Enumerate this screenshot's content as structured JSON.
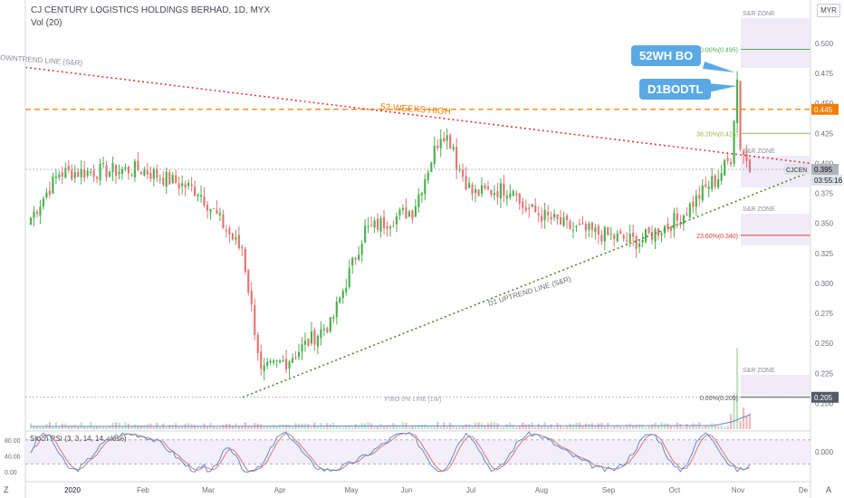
{
  "header": {
    "symbol_line": "CJ CENTURY LOGISTICS HOLDINGS BERHAD, 1D, MYX",
    "volume_label": "Vol (20)"
  },
  "currency_button": "MYR",
  "bottom_buttons": {
    "left": "Z",
    "right": "A"
  },
  "annotations": {
    "downtrend": "OWNTREND LINE (S&R)",
    "high52": "52 WEEKS HIGH",
    "uptrend": "D1 UPTREND LINE (S&R)",
    "fibo0": "FIBO 0% LINE [1W]",
    "bubble1": "52WH BO",
    "bubble2": "D1BODTL",
    "zone": "S&R ZONE",
    "fib50": "50.00%(0.495)",
    "fib38": "38.20%(0.425)",
    "fib23": "23.60%(0.340)",
    "fib0": "0.00%(0.205)"
  },
  "price_tags": {
    "orange": "0.445",
    "ticker": "CJCEN",
    "last": "0.395",
    "countdown": "03:55:16",
    "bottom": "0.205"
  },
  "colors": {
    "up": "#4caf50",
    "down": "#e57373",
    "orange": "#f57c00",
    "trend_red": "#e53935",
    "trend_green": "#4a8c2a",
    "bubble": "#5aa9e6",
    "zone": "#ece6f7",
    "stoch_k": "#5b8fd6",
    "stoch_d": "#e57373"
  },
  "chart_data": [
    {
      "type": "candlestick",
      "price_axis": {
        "ylim": [
          0.195,
          0.515
        ],
        "ticks": [
          "0.500",
          "0.475",
          "0.450",
          "0.425",
          "0.400",
          "0.375",
          "0.350",
          "0.325",
          "0.300",
          "0.275",
          "0.250",
          "0.225",
          "0.200"
        ]
      },
      "time_axis": [
        "2020",
        "Feb",
        "Mar",
        "Apr",
        "May",
        "Jun",
        "Jul",
        "Aug",
        "Sep",
        "Oct",
        "Nov",
        "De"
      ],
      "reference_levels": {
        "high_52w": 0.445,
        "last": 0.395,
        "fibo_0": 0.205
      },
      "fibonacci": [
        {
          "label": "50.00%(0.495)",
          "value": 0.495
        },
        {
          "label": "38.20%(0.425)",
          "value": 0.425
        },
        {
          "label": "23.60%(0.340)",
          "value": 0.34
        },
        {
          "label": "0.00%(0.205)",
          "value": 0.205
        }
      ],
      "phases": [
        {
          "n": 10,
          "from": 0.355,
          "to": 0.392
        },
        {
          "n": 25,
          "from": 0.392,
          "to": 0.395
        },
        {
          "n": 18,
          "from": 0.395,
          "to": 0.378
        },
        {
          "n": 14,
          "from": 0.378,
          "to": 0.33
        },
        {
          "n": 6,
          "from": 0.33,
          "to": 0.245
        },
        {
          "n": 8,
          "from": 0.225,
          "to": 0.235
        },
        {
          "n": 14,
          "from": 0.235,
          "to": 0.265
        },
        {
          "n": 12,
          "from": 0.265,
          "to": 0.345
        },
        {
          "n": 14,
          "from": 0.345,
          "to": 0.36
        },
        {
          "n": 10,
          "from": 0.36,
          "to": 0.425
        },
        {
          "n": 4,
          "from": 0.425,
          "to": 0.415
        },
        {
          "n": 6,
          "from": 0.4,
          "to": 0.375
        },
        {
          "n": 14,
          "from": 0.375,
          "to": 0.38
        },
        {
          "n": 18,
          "from": 0.365,
          "to": 0.345
        },
        {
          "n": 20,
          "from": 0.345,
          "to": 0.335
        },
        {
          "n": 12,
          "from": 0.335,
          "to": 0.352
        },
        {
          "n": 12,
          "from": 0.352,
          "to": 0.385
        },
        {
          "n": 6,
          "from": 0.385,
          "to": 0.405
        },
        {
          "n": 2,
          "from": 0.44,
          "to": 0.47
        },
        {
          "n": 4,
          "from": 0.415,
          "to": 0.395
        }
      ]
    },
    {
      "type": "line",
      "title": "Stoch RSI (3, 3, 14, 14, close)",
      "ylim": [
        -20,
        100
      ],
      "ticks": [
        "80.00",
        "40.00",
        "0.00"
      ],
      "right_tick": "0.000"
    }
  ]
}
